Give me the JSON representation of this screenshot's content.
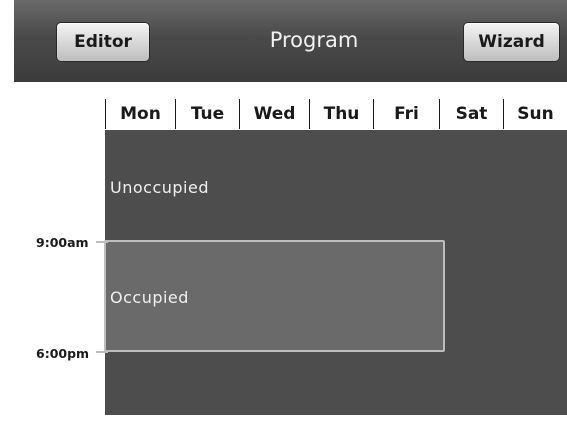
{
  "header": {
    "title": "Program",
    "editor_label": "Editor",
    "wizard_label": "Wizard"
  },
  "days": [
    "Mon",
    "Tue",
    "Wed",
    "Thu",
    "Fri",
    "Sat",
    "Sun"
  ],
  "periods": {
    "unoccupied_label": "Unoccupied",
    "occupied_label": "Occupied"
  },
  "times": {
    "start": "9:00am",
    "end": "6:00pm"
  },
  "colors": {
    "header_bg": "#4a4a4a",
    "grid_bg": "#4d4d4d",
    "occupied_bg": "#6a6a6a",
    "occupied_border": "#bdbdbd",
    "button_bg": "#d6d6d6"
  }
}
